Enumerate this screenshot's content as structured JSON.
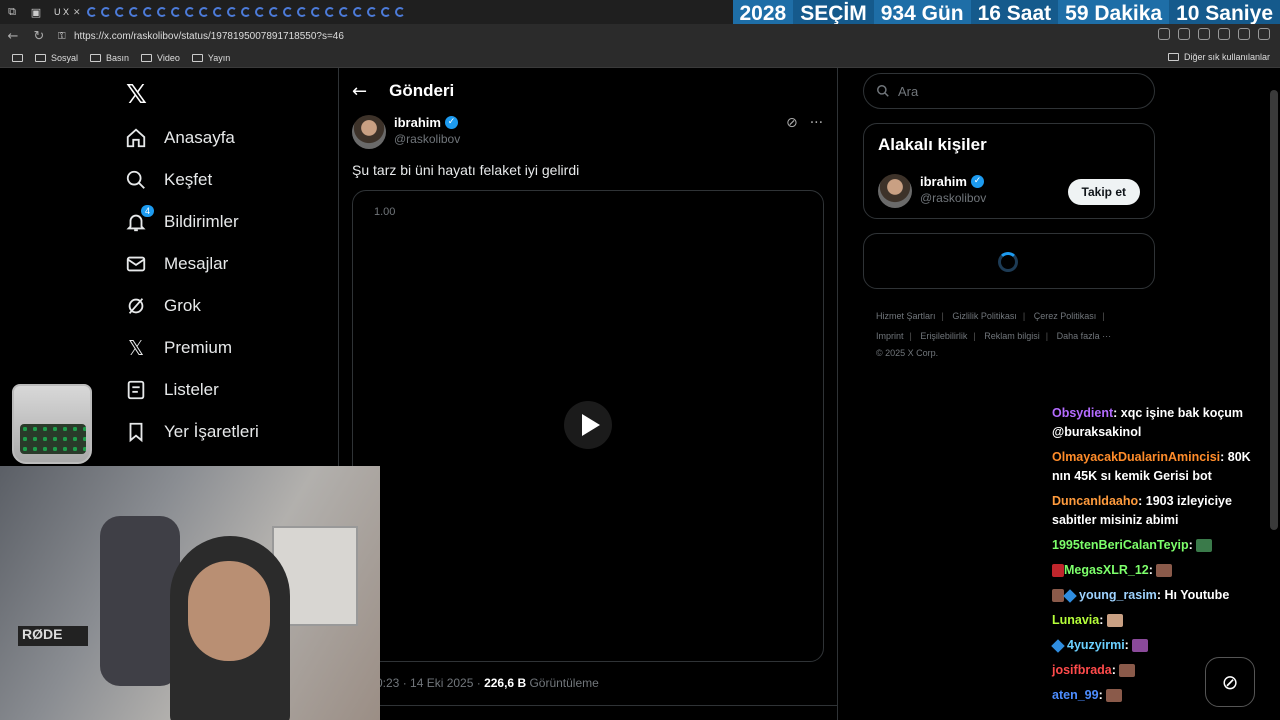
{
  "browser": {
    "url": "https://x.com/raskolibov/status/1978195007891718550?s=46",
    "bookmarks": [
      "Sosyal",
      "Basın",
      "Video",
      "Yayın"
    ],
    "bookmarks_other": "Diğer sık kullanılanlar",
    "tab_label": "U X"
  },
  "countdown": {
    "year": "2028",
    "label": "SEÇİM",
    "days": "934 Gün",
    "hours": "16 Saat",
    "minutes": "59 Dakika",
    "seconds": "10 Saniye"
  },
  "sidebar": {
    "items": [
      {
        "label": "Anasayfa",
        "icon": "home-icon"
      },
      {
        "label": "Keşfet",
        "icon": "search-icon"
      },
      {
        "label": "Bildirimler",
        "icon": "bell-icon",
        "badge": "4"
      },
      {
        "label": "Mesajlar",
        "icon": "mail-icon"
      },
      {
        "label": "Grok",
        "icon": "grok-icon"
      },
      {
        "label": "Premium",
        "icon": "x-logo-icon"
      },
      {
        "label": "Listeler",
        "icon": "list-icon"
      },
      {
        "label": "Yer İşaretleri",
        "icon": "bookmark-icon"
      }
    ]
  },
  "post": {
    "header_title": "Gönderi",
    "author_name": "ibrahim",
    "author_handle": "@raskolibov",
    "text": "Şu tarz bi üni hayatı felaket iyi gelirdi",
    "video_speed": "1.00",
    "time": "0:23 · 14 Eki 2025 · ",
    "views": "226,6 B",
    "views_label": " Görüntüleme"
  },
  "right": {
    "search_placeholder": "Ara",
    "related_title": "Alakalı kişiler",
    "related_name": "ibrahim",
    "related_handle": "@raskolibov",
    "follow_label": "Takip et",
    "footer": [
      "Hizmet Şartları",
      "Gizlilik Politikası",
      "Çerez Politikası",
      "Imprint",
      "Erişilebilirlik",
      "Reklam bilgisi",
      "Daha fazla ···"
    ],
    "copyright": "© 2025 X Corp."
  },
  "chat": [
    {
      "user": "Obsydient",
      "color": "#b46cff",
      "text": "xqc işine bak koçum @buraksakinol"
    },
    {
      "user": "OlmayacakDualarinAmincisi",
      "color": "#ff8c2a",
      "text": "80K nın 45K sı kemik Gerisi bot"
    },
    {
      "user": "Duncanldaaho",
      "color": "#ff9b3d",
      "text": "1903 izleyiciye sabitler misiniz abimi"
    },
    {
      "user": "1995tenBeriCalanTeyip",
      "color": "#7dff6b",
      "text": ""
    },
    {
      "user": "MegasXLR_12",
      "color": "#7dff6b",
      "text": ""
    },
    {
      "user": "young_rasim",
      "color": "#9fd3ff",
      "text": "Hı Youtube"
    },
    {
      "user": "Lunavia",
      "color": "#b6ff3a",
      "text": ""
    },
    {
      "user": "4yuzyirmi",
      "color": "#6bd0ff",
      "text": ""
    },
    {
      "user": "josifbrada",
      "color": "#ff4b4b",
      "text": ""
    },
    {
      "user": "aten_99",
      "color": "#4d8dff",
      "text": ""
    }
  ],
  "webcam": {
    "mic_brand": "RØDE"
  }
}
